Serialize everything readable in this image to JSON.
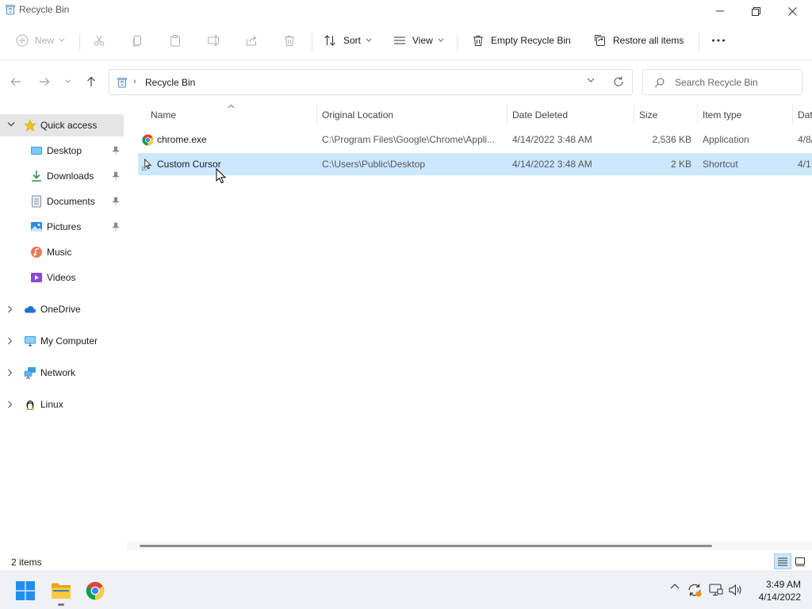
{
  "window": {
    "title": "Recycle Bin"
  },
  "commandbar": {
    "new_label": "New",
    "sort_label": "Sort",
    "view_label": "View",
    "empty_label": "Empty Recycle Bin",
    "restore_label": "Restore all items",
    "more_label": "..."
  },
  "address": {
    "crumb": "Recycle Bin",
    "search_placeholder": "Search Recycle Bin"
  },
  "sidebar": {
    "items": [
      {
        "label": "Quick access",
        "icon": "star-icon",
        "selected": true
      },
      {
        "label": "Desktop",
        "icon": "desktop-folder-icon",
        "pinned": true
      },
      {
        "label": "Downloads",
        "icon": "downloads-icon",
        "pinned": true
      },
      {
        "label": "Documents",
        "icon": "documents-icon",
        "pinned": true
      },
      {
        "label": "Pictures",
        "icon": "pictures-icon",
        "pinned": true
      },
      {
        "label": "Music",
        "icon": "music-icon"
      },
      {
        "label": "Videos",
        "icon": "videos-icon"
      },
      {
        "label": "OneDrive",
        "icon": "cloud-icon"
      },
      {
        "label": "My Computer",
        "icon": "monitor-icon"
      },
      {
        "label": "Network",
        "icon": "network-icon"
      },
      {
        "label": "Linux",
        "icon": "linux-penguin-icon"
      }
    ]
  },
  "table": {
    "columns": [
      "Name",
      "Original Location",
      "Date Deleted",
      "Size",
      "Item type",
      "Dat"
    ],
    "rows": [
      {
        "name": "chrome.exe",
        "location": "C:\\Program Files\\Google\\Chrome\\Appli...",
        "date": "4/14/2022 3:48 AM",
        "size": "2,536 KB",
        "type": "Application",
        "extra": "4/8/",
        "icon": "chrome-icon",
        "selected": false
      },
      {
        "name": "Custom Cursor",
        "location": "C:\\Users\\Public\\Desktop",
        "date": "4/14/2022 3:48 AM",
        "size": "2 KB",
        "type": "Shortcut",
        "extra": "4/1",
        "icon": "shortcut-cursor-icon",
        "selected": true
      }
    ]
  },
  "status": {
    "count": "2 items"
  },
  "taskbar": {
    "time": "3:49 AM",
    "date": "4/14/2022"
  },
  "colors": {
    "accent": "#0067c0",
    "selection": "#cce8ff",
    "sidebar_selected": "#e5e5e5",
    "taskbar": "#eef1f6"
  }
}
